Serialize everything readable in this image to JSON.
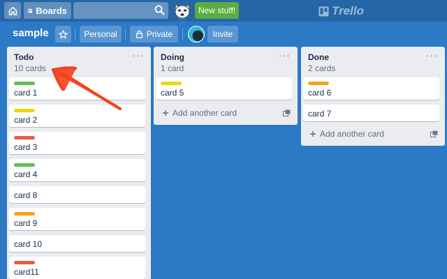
{
  "header": {
    "boards_label": "Boards",
    "search_value": "",
    "new_stuff_label": "New stuff!",
    "logo_text": "Trello"
  },
  "board": {
    "title": "sample",
    "team_label": "Personal",
    "visibility_label": "Private",
    "invite_label": "Invite"
  },
  "colors": {
    "green": "#61bd4f",
    "yellow": "#f2d600",
    "red": "#eb5a46",
    "orange": "#ff9f1a",
    "annotation_arrow": "#f5401e"
  },
  "lists": [
    {
      "title": "Todo",
      "count": "10 cards",
      "cards": [
        {
          "text": "card 1",
          "label": "green"
        },
        {
          "text": "card 2",
          "label": "yellow"
        },
        {
          "text": "card 3",
          "label": "red"
        },
        {
          "text": "card 4",
          "label": "green"
        },
        {
          "text": "card 8",
          "label": null
        },
        {
          "text": "card 9",
          "label": "orange"
        },
        {
          "text": "card 10",
          "label": null
        },
        {
          "text": "card11",
          "label": "red"
        }
      ]
    },
    {
      "title": "Doing",
      "count": "1 card",
      "cards": [
        {
          "text": "card 5",
          "label": "yellow"
        }
      ],
      "add_label": "Add another card"
    },
    {
      "title": "Done",
      "count": "2 cards",
      "cards": [
        {
          "text": "card 6",
          "label": "orange"
        },
        {
          "text": "card 7",
          "label": null
        }
      ],
      "add_label": "Add another card"
    }
  ],
  "icons": {
    "home": "home-icon",
    "boards": "boards-icon",
    "search": "search-icon",
    "star": "star-icon",
    "lock": "lock-icon",
    "list_menu": "ellipsis-icon",
    "add": "plus-icon",
    "template": "card-template-icon"
  }
}
